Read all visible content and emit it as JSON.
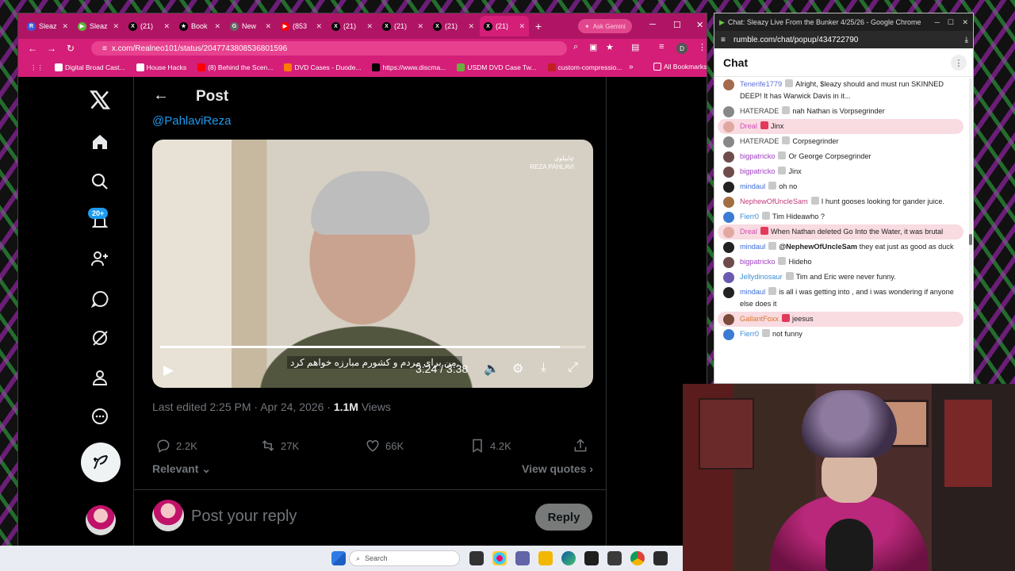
{
  "browser": {
    "tabs": [
      {
        "label": "Sleaz",
        "color": "#3b5bdb",
        "glyph": "R"
      },
      {
        "label": "Sleaz",
        "color": "#5ab535",
        "glyph": "▶"
      },
      {
        "label": "(21)",
        "color": "#000000",
        "glyph": "X"
      },
      {
        "label": "Book",
        "color": "#000000",
        "glyph": "★"
      },
      {
        "label": "New",
        "color": "#666666",
        "glyph": "G"
      },
      {
        "label": "(853",
        "color": "#ff0000",
        "glyph": "▶"
      },
      {
        "label": "(21)",
        "color": "#000000",
        "glyph": "X"
      },
      {
        "label": "(21)",
        "color": "#000000",
        "glyph": "X"
      },
      {
        "label": "(21)",
        "color": "#000000",
        "glyph": "X"
      },
      {
        "label": "(21)",
        "color": "#000000",
        "glyph": "X"
      }
    ],
    "ask_label": "Ask Gemini",
    "url": "x.com/Realneo101/status/2047743808536801596",
    "profile_initial": "D",
    "bookmarks": [
      {
        "label": "Digital Broad Cast...",
        "color": "#ffffff"
      },
      {
        "label": "House Hacks",
        "color": "#ffffff"
      },
      {
        "label": "(8) Behind the Scen...",
        "color": "#ff0000"
      },
      {
        "label": "DVD Cases - Duode...",
        "color": "#ff7a00"
      },
      {
        "label": "https://www.discma...",
        "color": "#000000"
      },
      {
        "label": "USDM DVD Case Tw...",
        "color": "#69b03c"
      },
      {
        "label": "custom-compressio...",
        "color": "#c02020"
      }
    ],
    "all_bookmarks": "All Bookmarks"
  },
  "x": {
    "nav_badge": "20+",
    "post_header": "Post",
    "mention": "@PahlaviReza",
    "video": {
      "logo_text": "چایپلوی\nREZA PAHLAVI",
      "caption": "من برای مردم و کشورم مبارزه خواهم کرد.",
      "time": "3:24 / 3:38",
      "progress": 0.94
    },
    "meta": {
      "edited": "Last edited 2:25 PM · Apr 24, 2026 · ",
      "views_count": "1.1M",
      "views_label": " Views"
    },
    "actions": {
      "replies": "2.2K",
      "reposts": "27K",
      "likes": "66K",
      "bookmarks": "4.2K"
    },
    "sort_label": "Relevant",
    "view_quotes": "View quotes",
    "reply_placeholder": "Post your reply",
    "reply_button": "Reply"
  },
  "chat": {
    "window_title": "Chat: Sleazy Live From the Bunker 4/25/26 - Google Chrome",
    "url": "rumble.com/chat/popup/434722790",
    "title": "Chat",
    "messages": [
      {
        "user": "Tenerife1779",
        "color": "#5b6fd8",
        "text": "Alright, $leazy should and must run SKINNED DEEP! It has Warwick Davis in it...",
        "avatar": "#a46b4c",
        "hl": false
      },
      {
        "user": "HATERADE",
        "color": "#444444",
        "text": "nah Nathan is Vorpsegrinder",
        "avatar": "#888888",
        "hl": false
      },
      {
        "user": "Dreal",
        "color": "#d14ab8",
        "text": "Jinx",
        "avatar": "#e0a9a0",
        "hl": true
      },
      {
        "user": "HATERADE",
        "color": "#444444",
        "text": "Corpsegrinder",
        "avatar": "#888888",
        "hl": false
      },
      {
        "user": "bigpatricko",
        "color": "#a040c0",
        "text": "Or George Corpsegrinder",
        "avatar": "#6e4c4c",
        "hl": false
      },
      {
        "user": "bigpatricko",
        "color": "#a040c0",
        "text": "Jinx",
        "avatar": "#6e4c4c",
        "hl": false
      },
      {
        "user": "mindaul",
        "color": "#3c6bd6",
        "text": "oh no",
        "avatar": "#222222",
        "hl": false
      },
      {
        "user": "NephewOfUncleSam",
        "color": "#c23a7a",
        "text": "I hunt gooses looking for gander juice.",
        "avatar": "#a07040",
        "hl": false
      },
      {
        "user": "Fierr0",
        "color": "#3c8fd6",
        "text": "Tim Hideawho ?",
        "avatar": "#3a7bd5",
        "hl": false
      },
      {
        "user": "Dreal",
        "color": "#d14ab8",
        "text": "When Nathan deleted Go Into the Water, it was brutal",
        "avatar": "#e0a9a0",
        "hl": true
      },
      {
        "user": "mindaul",
        "color": "#3c6bd6",
        "mention": "@NephewOfUncleSam",
        "text": " they eat just as good as duck",
        "avatar": "#222222",
        "hl": false
      },
      {
        "user": "bigpatricko",
        "color": "#a040c0",
        "text": "Hideho",
        "avatar": "#6e4c4c",
        "hl": false
      },
      {
        "user": "Jellydinosaur",
        "color": "#3c8fd6",
        "text": "Tim and Eric were never funny.",
        "avatar": "#6a5ab0",
        "hl": false
      },
      {
        "user": "mindaul",
        "color": "#3c6bd6",
        "text": "is all i was getting into , and i was wondering if anyone else does it",
        "avatar": "#222222",
        "hl": false
      },
      {
        "user": "GallantFoxx",
        "color": "#d8782a",
        "text": "jeesus",
        "avatar": "#7a4a3a",
        "hl": true
      },
      {
        "user": "Fierr0",
        "color": "#3c8fd6",
        "text": "not funny",
        "avatar": "#3a7bd5",
        "hl": false
      }
    ]
  },
  "taskbar": {
    "search_label": "Search"
  }
}
